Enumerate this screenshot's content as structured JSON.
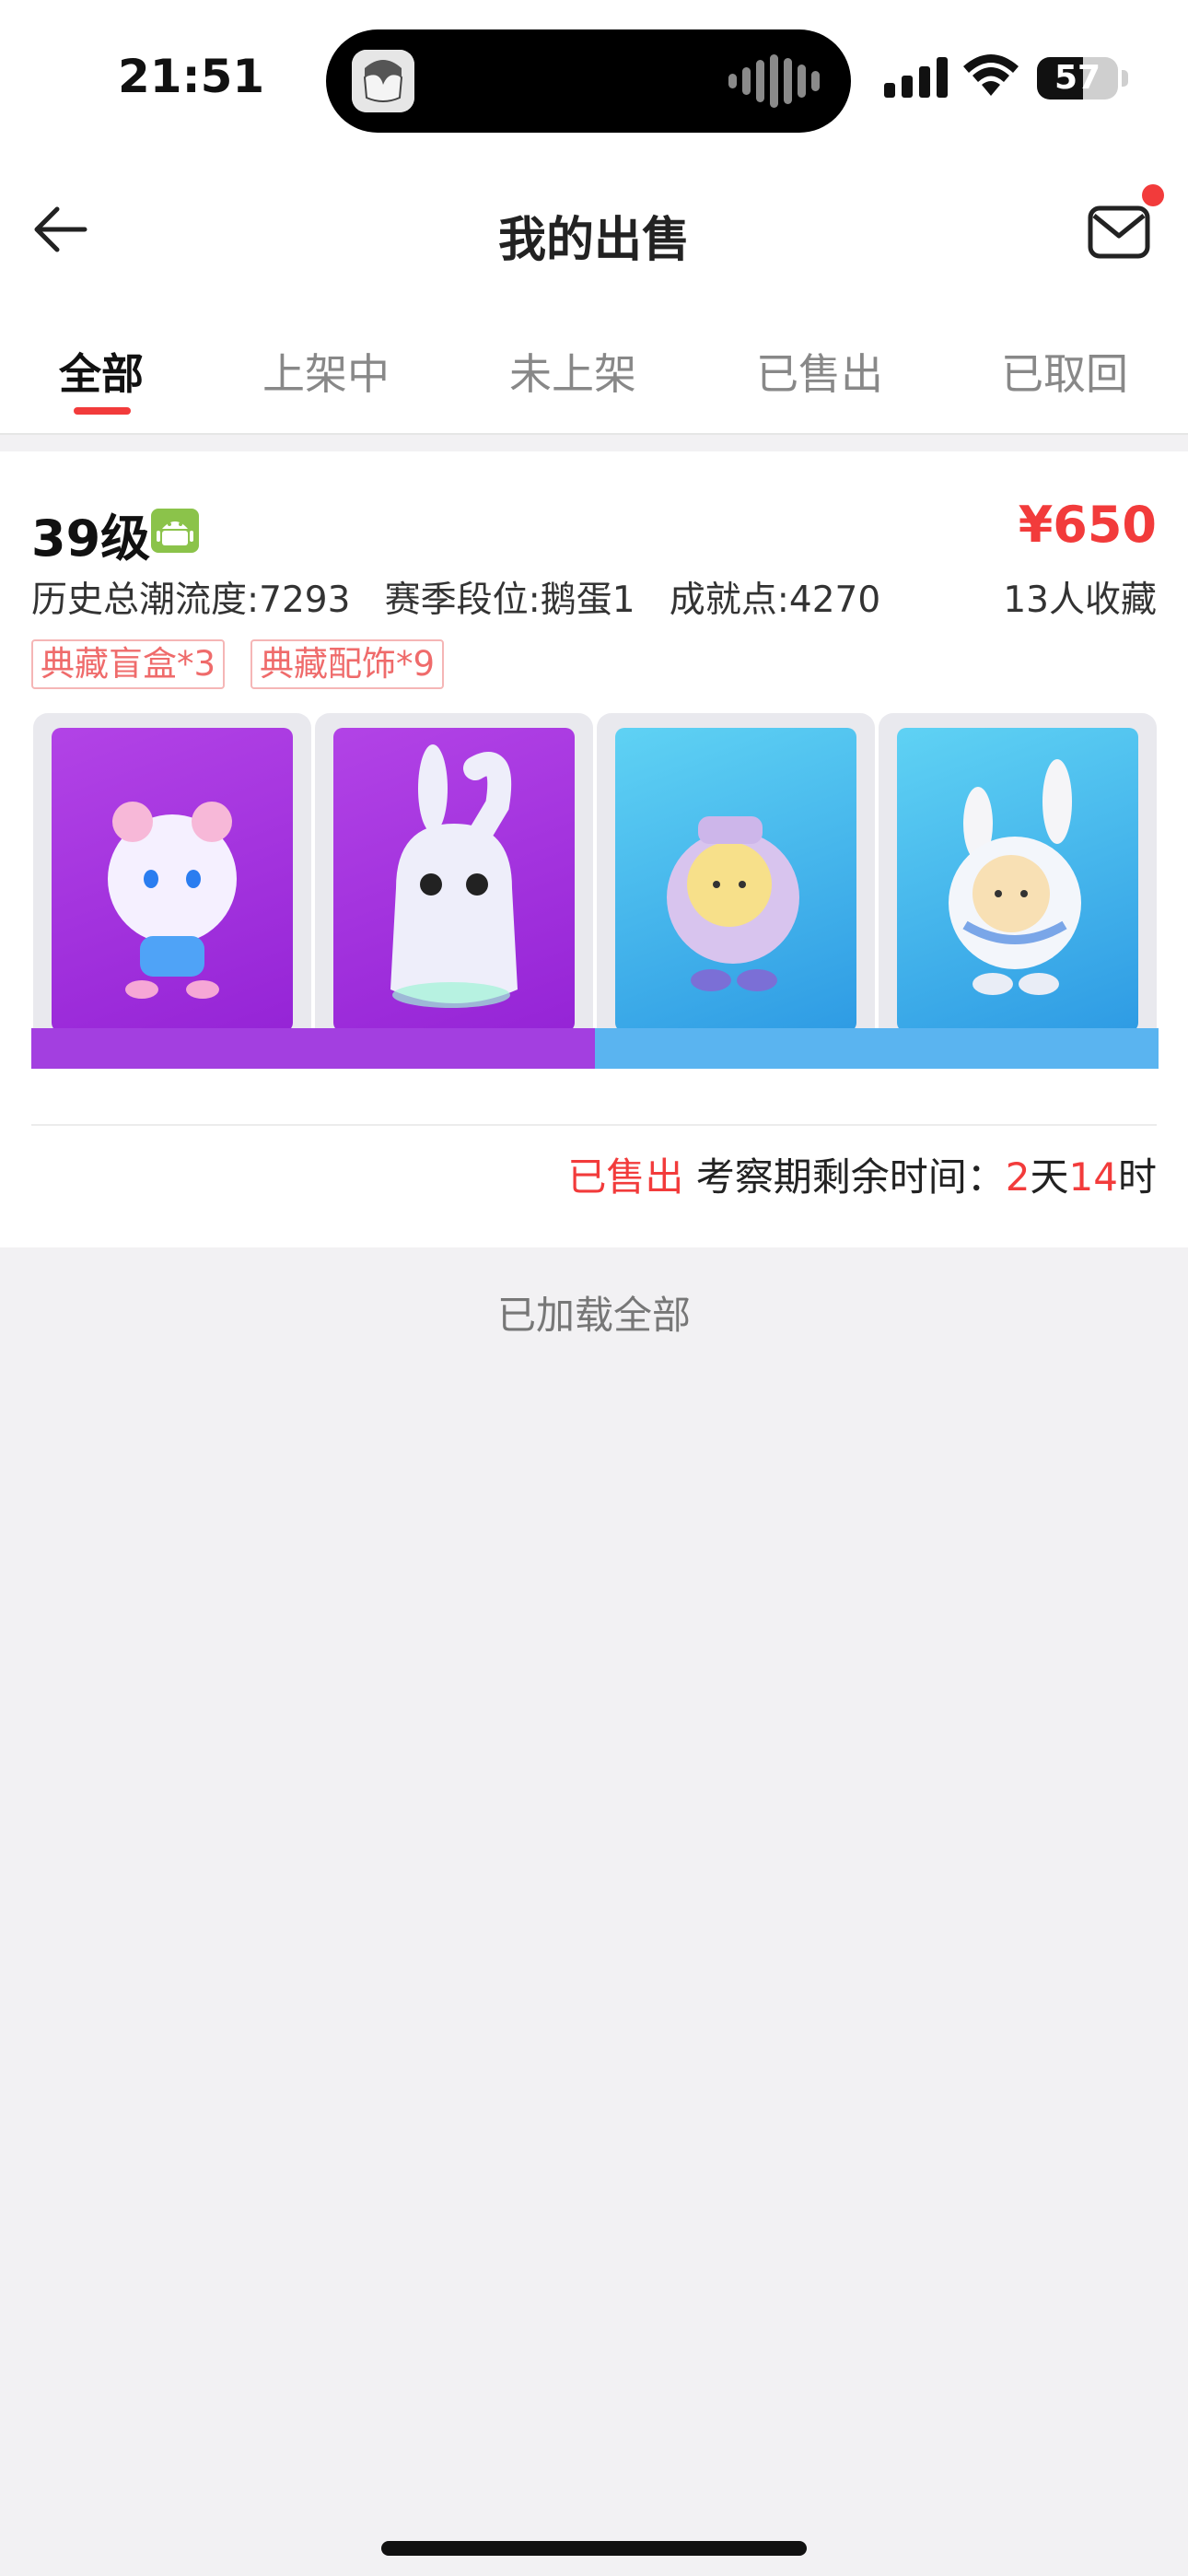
{
  "status_bar": {
    "time": "21:51",
    "battery": "57",
    "battery_level": 0.57
  },
  "nav": {
    "title": "我的出售",
    "back_icon": "arrow-left-icon",
    "mail_icon": "mail-icon",
    "has_unread": true
  },
  "tabs": [
    {
      "label": "全部",
      "active": true
    },
    {
      "label": "上架中",
      "active": false
    },
    {
      "label": "未上架",
      "active": false
    },
    {
      "label": "已售出",
      "active": false
    },
    {
      "label": "已取回",
      "active": false
    }
  ],
  "listing": {
    "level": "39级",
    "platform_icon": "android-icon",
    "price": "¥650",
    "stats": {
      "history": "历史总潮流度:7293",
      "season": "赛季段位:鹅蛋1",
      "achievement": "成就点:4270"
    },
    "favorites": "13人收藏",
    "tags": [
      "典藏盲盒*3",
      "典藏配饰*9"
    ],
    "items": [
      {
        "name": "pink-bear-figure",
        "color": "#9b2bd8"
      },
      {
        "name": "ghost-bunny-figure",
        "color": "#9b2bd8"
      },
      {
        "name": "purple-egg-figure",
        "color": "#3aa8ea"
      },
      {
        "name": "cake-bunny-figure",
        "color": "#3aa8ea"
      }
    ],
    "sold_label": "已售出",
    "review_prefix": "考察期剩余时间：",
    "days": "2",
    "days_unit": "天",
    "hours": "14",
    "hours_unit": "时"
  },
  "footer": {
    "loaded_all": "已加载全部"
  },
  "colors": {
    "accent_red": "#f23b3b",
    "tag_text": "#ef6b6b",
    "background": "#f2f1f3"
  }
}
